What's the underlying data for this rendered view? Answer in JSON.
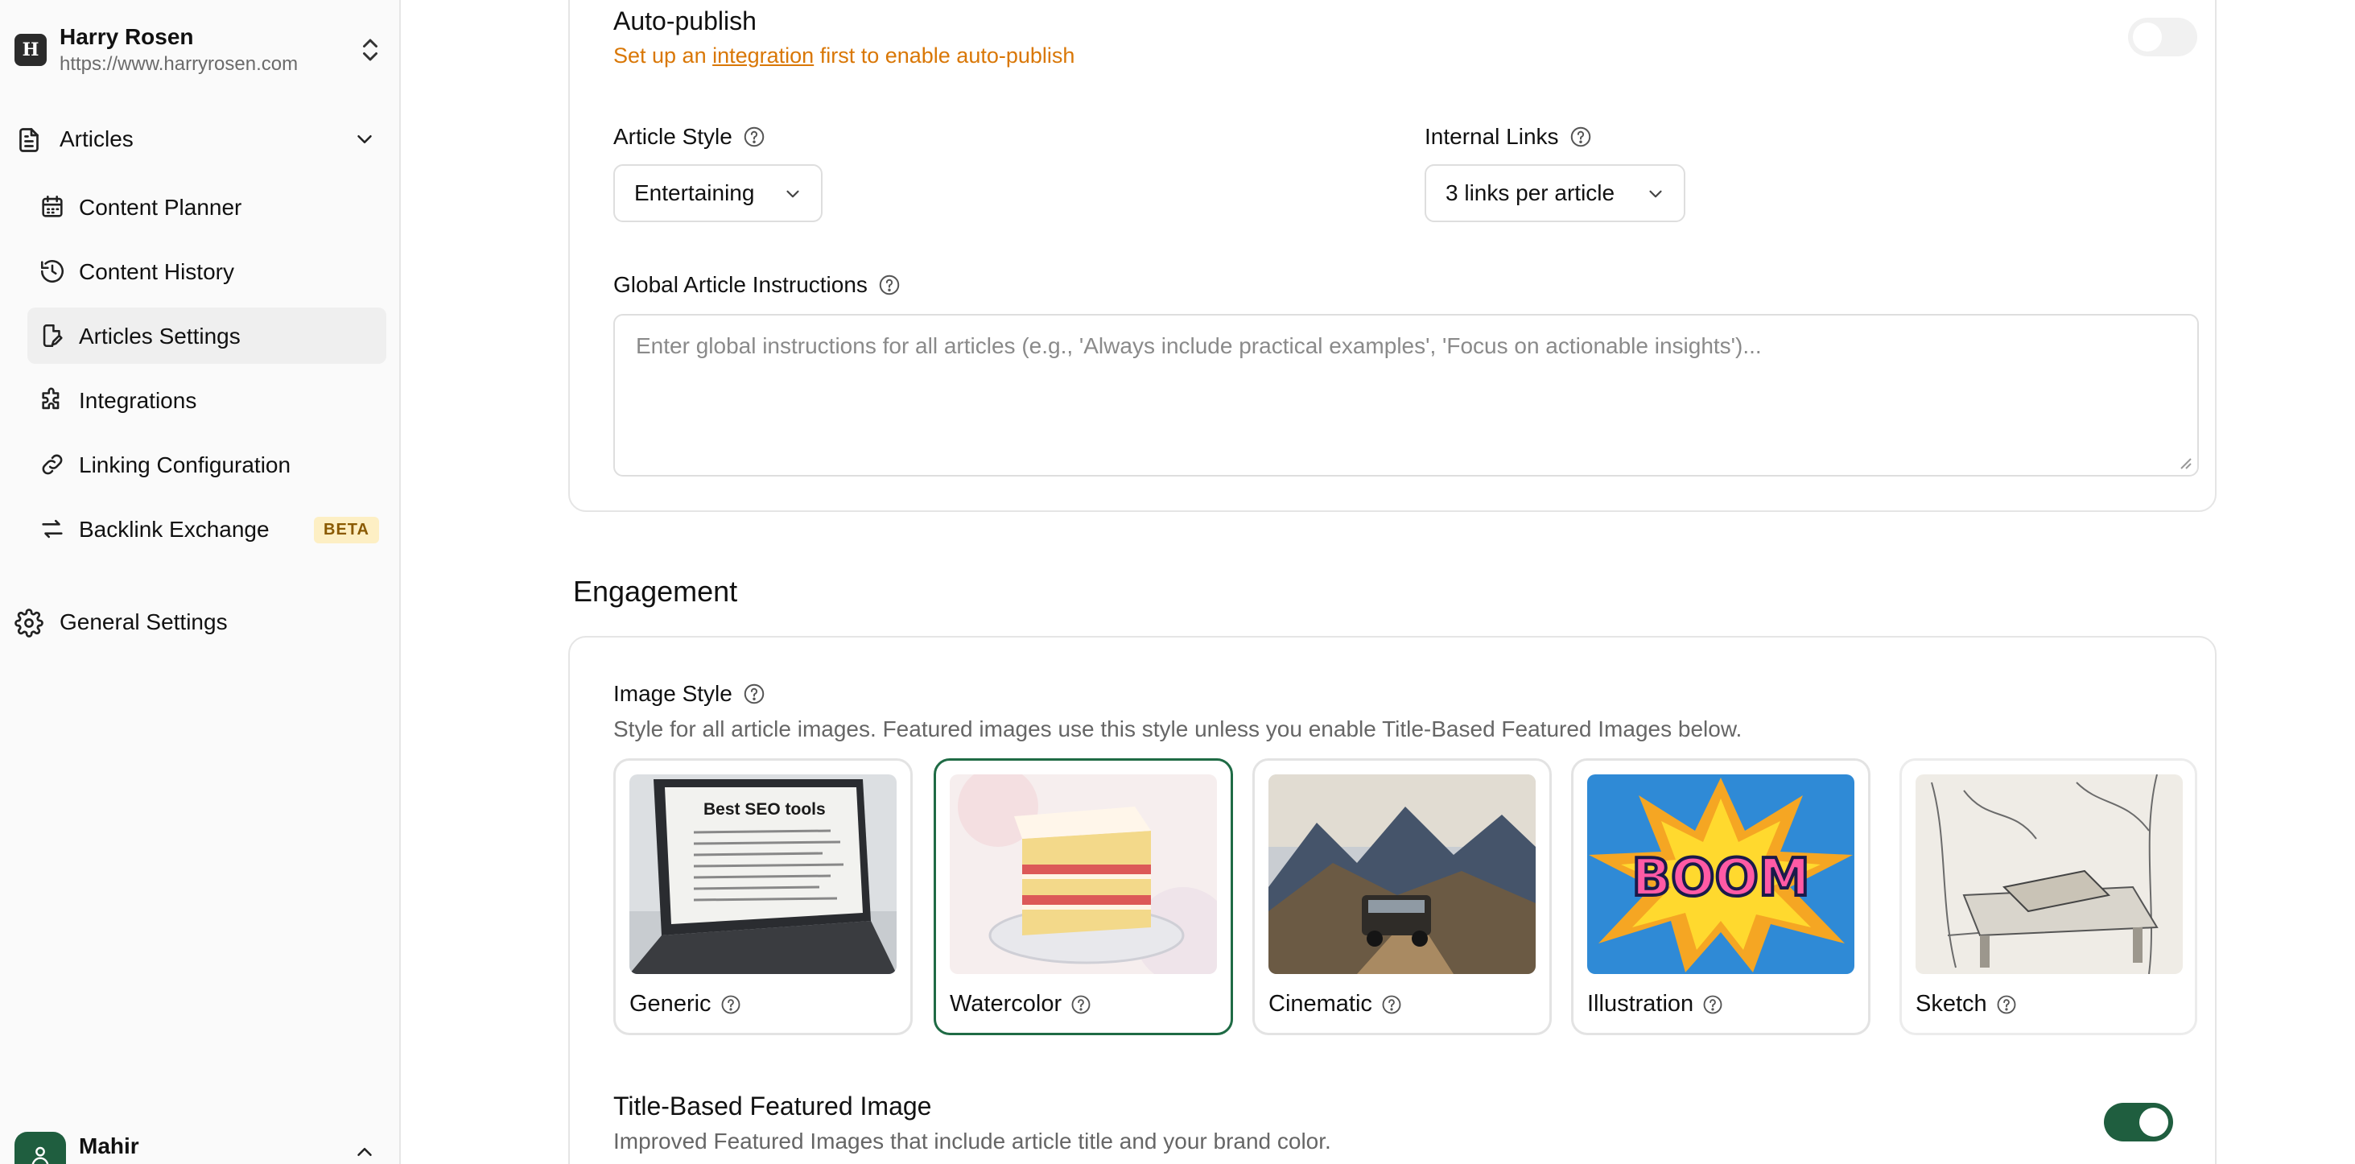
{
  "workspace": {
    "logo_letter": "H",
    "name": "Harry Rosen",
    "url": "https://www.harryrosen.com"
  },
  "sidebar": {
    "articles_label": "Articles",
    "items": [
      {
        "label": "Content Planner",
        "icon": "calendar-icon"
      },
      {
        "label": "Content History",
        "icon": "history-icon"
      },
      {
        "label": "Articles Settings",
        "icon": "edit-document-icon"
      },
      {
        "label": "Integrations",
        "icon": "puzzle-icon"
      },
      {
        "label": "Linking Configuration",
        "icon": "link-icon"
      },
      {
        "label": "Backlink Exchange",
        "icon": "exchange-icon",
        "badge": "BETA"
      }
    ],
    "general_settings_label": "General Settings",
    "user_name": "Mahir"
  },
  "settings": {
    "auto_publish": {
      "title": "Auto-publish",
      "warning_pre": "Set up an ",
      "warning_link": "integration",
      "warning_post": " first to enable auto-publish",
      "enabled": false
    },
    "article_style": {
      "label": "Article Style",
      "value": "Entertaining"
    },
    "internal_links": {
      "label": "Internal Links",
      "value": "3 links per article"
    },
    "global_instructions": {
      "label": "Global Article Instructions",
      "placeholder": "Enter global instructions for all articles (e.g., 'Always include practical examples', 'Focus on actionable insights')..."
    }
  },
  "engagement": {
    "title": "Engagement",
    "image_style": {
      "label": "Image Style",
      "description": "Style for all article images. Featured images use this style unless you enable Title-Based Featured Images below.",
      "options": [
        {
          "name": "Generic",
          "selected": false,
          "thumb_text": "Best SEO tools"
        },
        {
          "name": "Watercolor",
          "selected": true
        },
        {
          "name": "Cinematic",
          "selected": false
        },
        {
          "name": "Illustration",
          "selected": false,
          "thumb_text": "BOOM"
        },
        {
          "name": "Sketch",
          "selected": false
        }
      ]
    },
    "title_based": {
      "title": "Title-Based Featured Image",
      "description": "Improved Featured Images that include article title and your brand color.",
      "enabled": true
    }
  },
  "colors": {
    "accent": "#1f5e3f",
    "warning": "#d97706",
    "beta_bg": "#fdefc4"
  }
}
